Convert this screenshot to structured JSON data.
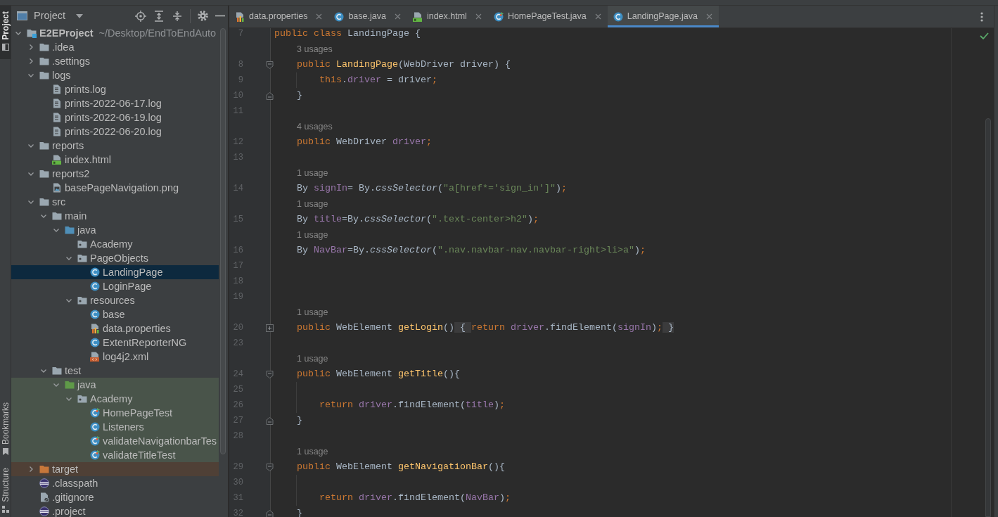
{
  "tool_strip": {
    "top": [
      {
        "label": "Project",
        "kind": "project",
        "selected": true
      }
    ],
    "bottom": [
      {
        "label": "Bookmarks",
        "kind": "bookmarks",
        "selected": false
      },
      {
        "label": "Structure",
        "kind": "structure",
        "selected": false
      }
    ]
  },
  "project_panel": {
    "title": "Project",
    "tree": [
      {
        "label": "E2EProject",
        "kind": "module",
        "path": "~/Desktop/EndToEndAuto",
        "expanded": true,
        "selected": false,
        "children": [
          {
            "label": ".idea",
            "kind": "folder",
            "expanded": false,
            "selected": false
          },
          {
            "label": ".settings",
            "kind": "folder",
            "expanded": false,
            "selected": false
          },
          {
            "label": "logs",
            "kind": "folder",
            "expanded": true,
            "selected": false,
            "children": [
              {
                "label": "prints.log",
                "kind": "text_file",
                "selected": false
              },
              {
                "label": "prints-2022-06-17.log",
                "kind": "text_file",
                "selected": false
              },
              {
                "label": "prints-2022-06-19.log",
                "kind": "text_file",
                "selected": false
              },
              {
                "label": "prints-2022-06-20.log",
                "kind": "text_file",
                "selected": false
              }
            ]
          },
          {
            "label": "reports",
            "kind": "folder",
            "expanded": true,
            "selected": false,
            "children": [
              {
                "label": "index.html",
                "kind": "html",
                "selected": false
              }
            ]
          },
          {
            "label": "reports2",
            "kind": "folder",
            "expanded": true,
            "selected": false,
            "children": [
              {
                "label": "basePageNavigation.png",
                "kind": "image",
                "selected": false
              }
            ]
          },
          {
            "label": "src",
            "kind": "folder",
            "expanded": true,
            "selected": false,
            "children": [
              {
                "label": "main",
                "kind": "folder",
                "expanded": true,
                "selected": false,
                "children": [
                  {
                    "label": "java",
                    "kind": "source_root",
                    "expanded": true,
                    "selected": false,
                    "children": [
                      {
                        "label": "Academy",
                        "kind": "package",
                        "selected": false
                      },
                      {
                        "label": "PageObjects",
                        "kind": "package",
                        "expanded": true,
                        "selected": false,
                        "children": [
                          {
                            "label": "LandingPage",
                            "kind": "class",
                            "selected": true
                          },
                          {
                            "label": "LoginPage",
                            "kind": "class",
                            "selected": false
                          }
                        ]
                      },
                      {
                        "label": "resources",
                        "kind": "package",
                        "expanded": true,
                        "selected": false,
                        "children": [
                          {
                            "label": "base",
                            "kind": "class",
                            "selected": false
                          },
                          {
                            "label": "data.properties",
                            "kind": "properties",
                            "selected": false
                          },
                          {
                            "label": "ExtentReporterNG",
                            "kind": "class",
                            "selected": false
                          },
                          {
                            "label": "log4j2.xml",
                            "kind": "xml",
                            "selected": false
                          }
                        ]
                      }
                    ]
                  }
                ]
              },
              {
                "label": "test",
                "kind": "folder",
                "expanded": true,
                "selected": false,
                "children": [
                  {
                    "label": "java",
                    "kind": "test_root",
                    "test_source": true,
                    "expanded": true,
                    "selected": false,
                    "children": [
                      {
                        "label": "Academy",
                        "kind": "package",
                        "test_source": true,
                        "expanded": true,
                        "selected": false,
                        "children": [
                          {
                            "label": "HomePageTest",
                            "kind": "test_class",
                            "test_source": true,
                            "selected": false
                          },
                          {
                            "label": "Listeners",
                            "kind": "class",
                            "test_source": true,
                            "selected": false
                          },
                          {
                            "label": "validateNavigationbarTes",
                            "kind": "test_class",
                            "test_source": true,
                            "selected": false
                          },
                          {
                            "label": "validateTitleTest",
                            "kind": "test_class",
                            "test_source": true,
                            "selected": false
                          }
                        ]
                      }
                    ]
                  }
                ]
              }
            ]
          },
          {
            "label": "target",
            "kind": "excluded_folder",
            "excluded": true,
            "expanded": false,
            "selected": false
          },
          {
            "label": ".classpath",
            "kind": "eclipse",
            "selected": false
          },
          {
            "label": ".gitignore",
            "kind": "ignore",
            "selected": false
          },
          {
            "label": ".project",
            "kind": "eclipse",
            "selected": false
          }
        ]
      }
    ]
  },
  "editor": {
    "tabs": [
      {
        "label": "data.properties",
        "kind": "properties",
        "selected": false
      },
      {
        "label": "base.java",
        "kind": "class",
        "selected": false
      },
      {
        "label": "index.html",
        "kind": "html",
        "selected": false
      },
      {
        "label": "HomePageTest.java",
        "kind": "test_class",
        "selected": false
      },
      {
        "label": "LandingPage.java",
        "kind": "class",
        "selected": true
      }
    ],
    "lines": [
      {
        "number": "7",
        "tokens": [
          {
            "text": "public class ",
            "kind": "keyword"
          },
          {
            "text": "LandingPage {",
            "kind": "plain"
          }
        ],
        "children": [
          {
            "number": "8",
            "hint": "3 usages",
            "collapsed": false,
            "tokens": [
              {
                "text": "public ",
                "kind": "keyword"
              },
              {
                "text": "LandingPage",
                "kind": "declaration"
              },
              {
                "text": "(WebDriver driver) {",
                "kind": "plain"
              }
            ],
            "children": [
              {
                "number": "9",
                "tokens": [
                  {
                    "text": "this",
                    "kind": "keyword"
                  },
                  {
                    "text": ".",
                    "kind": "plain"
                  },
                  {
                    "text": "driver",
                    "kind": "field"
                  },
                  {
                    "text": " = driver",
                    "kind": "plain"
                  },
                  {
                    "text": ";",
                    "kind": "semicolon"
                  }
                ]
              }
            ]
          },
          {
            "number": "10",
            "block_end": true,
            "tokens": [
              {
                "text": "}",
                "kind": "plain"
              }
            ]
          },
          {
            "number": "11"
          },
          {
            "number": "12",
            "hint": "4 usages",
            "tokens": [
              {
                "text": "public ",
                "kind": "keyword"
              },
              {
                "text": "WebDriver ",
                "kind": "plain"
              },
              {
                "text": "driver",
                "kind": "field"
              },
              {
                "text": ";",
                "kind": "semicolon"
              }
            ]
          },
          {
            "number": "13"
          },
          {
            "number": "14",
            "hint": "1 usage",
            "tokens": [
              {
                "text": "By ",
                "kind": "plain"
              },
              {
                "text": "signIn",
                "kind": "field"
              },
              {
                "text": "= By.",
                "kind": "plain"
              },
              {
                "text": "cssSelector",
                "kind": "static_method"
              },
              {
                "text": "(",
                "kind": "plain"
              },
              {
                "text": "\"a[href*='sign_in']\"",
                "kind": "string"
              },
              {
                "text": ")",
                "kind": "plain"
              },
              {
                "text": ";",
                "kind": "semicolon"
              }
            ]
          },
          {
            "number": "15",
            "hint": "1 usage",
            "tokens": [
              {
                "text": "By ",
                "kind": "plain"
              },
              {
                "text": "title",
                "kind": "field"
              },
              {
                "text": "=By.",
                "kind": "plain"
              },
              {
                "text": "cssSelector",
                "kind": "static_method"
              },
              {
                "text": "(",
                "kind": "plain"
              },
              {
                "text": "\".text-center>h2\"",
                "kind": "string"
              },
              {
                "text": ")",
                "kind": "plain"
              },
              {
                "text": ";",
                "kind": "semicolon"
              }
            ]
          },
          {
            "number": "16",
            "hint": "1 usage",
            "tokens": [
              {
                "text": "By ",
                "kind": "plain"
              },
              {
                "text": "NavBar",
                "kind": "field"
              },
              {
                "text": "=By.",
                "kind": "plain"
              },
              {
                "text": "cssSelector",
                "kind": "static_method"
              },
              {
                "text": "(",
                "kind": "plain"
              },
              {
                "text": "\".nav.navbar-nav.navbar-right>li>a\"",
                "kind": "string"
              },
              {
                "text": ")",
                "kind": "plain"
              },
              {
                "text": ";",
                "kind": "semicolon"
              }
            ]
          },
          {
            "number": "17"
          },
          {
            "number": "18"
          },
          {
            "number": "19"
          },
          {
            "number": "20",
            "hint": "1 usage",
            "collapsed": true,
            "tokens": [
              {
                "text": "public ",
                "kind": "keyword"
              },
              {
                "text": "WebElement ",
                "kind": "plain"
              },
              {
                "text": "getLogin",
                "kind": "declaration"
              },
              {
                "text": "()",
                "kind": "plain"
              },
              {
                "text": " { ",
                "kind": "folded"
              },
              {
                "text": "return ",
                "kind": "keyword"
              },
              {
                "text": "driver",
                "kind": "field"
              },
              {
                "text": ".findElement(",
                "kind": "plain"
              },
              {
                "text": "signIn",
                "kind": "field"
              },
              {
                "text": ")",
                "kind": "plain"
              },
              {
                "text": ";",
                "kind": "semicolon"
              },
              {
                "text": " }",
                "kind": "folded"
              }
            ]
          },
          {
            "number": "23"
          },
          {
            "number": "24",
            "hint": "1 usage",
            "collapsed": false,
            "tokens": [
              {
                "text": "public ",
                "kind": "keyword"
              },
              {
                "text": "WebElement ",
                "kind": "plain"
              },
              {
                "text": "getTitle",
                "kind": "declaration"
              },
              {
                "text": "(){",
                "kind": "plain"
              }
            ],
            "children": [
              {
                "number": "25"
              },
              {
                "number": "26",
                "tokens": [
                  {
                    "text": "return ",
                    "kind": "keyword"
                  },
                  {
                    "text": "driver",
                    "kind": "field"
                  },
                  {
                    "text": ".findElement(",
                    "kind": "plain"
                  },
                  {
                    "text": "title",
                    "kind": "field"
                  },
                  {
                    "text": ")",
                    "kind": "plain"
                  },
                  {
                    "text": ";",
                    "kind": "semicolon"
                  }
                ]
              }
            ]
          },
          {
            "number": "27",
            "block_end": true,
            "tokens": [
              {
                "text": "}",
                "kind": "plain"
              }
            ]
          },
          {
            "number": "28"
          },
          {
            "number": "29",
            "hint": "1 usage",
            "collapsed": false,
            "tokens": [
              {
                "text": "public ",
                "kind": "keyword"
              },
              {
                "text": "WebElement ",
                "kind": "plain"
              },
              {
                "text": "getNavigationBar",
                "kind": "declaration"
              },
              {
                "text": "(){",
                "kind": "plain"
              }
            ],
            "children": [
              {
                "number": "30"
              },
              {
                "number": "31",
                "tokens": [
                  {
                    "text": "return ",
                    "kind": "keyword"
                  },
                  {
                    "text": "driver",
                    "kind": "field"
                  },
                  {
                    "text": ".findElement(",
                    "kind": "plain"
                  },
                  {
                    "text": "NavBar",
                    "kind": "field"
                  },
                  {
                    "text": ")",
                    "kind": "plain"
                  },
                  {
                    "text": ";",
                    "kind": "semicolon"
                  }
                ]
              }
            ]
          },
          {
            "number": "32",
            "block_end": true,
            "tokens": [
              {
                "text": "}",
                "kind": "plain"
              }
            ]
          }
        ]
      }
    ]
  }
}
